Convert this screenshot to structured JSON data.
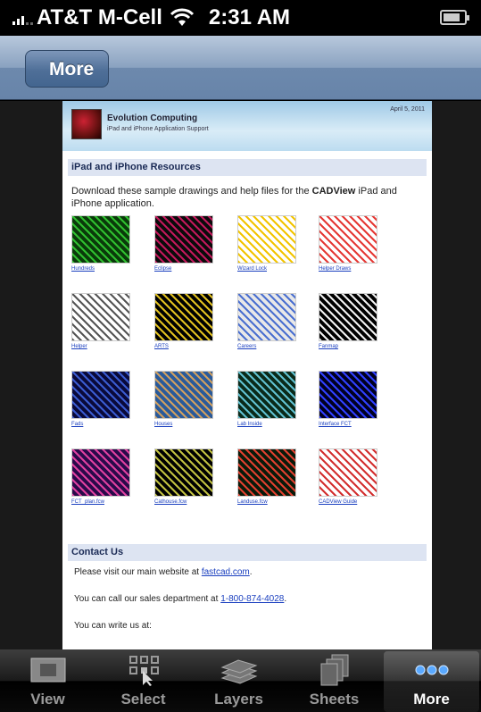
{
  "status_bar": {
    "carrier": "AT&T M-Cell",
    "time": "2:31 AM"
  },
  "nav": {
    "back_label": "More"
  },
  "page": {
    "company_name": "Evolution Computing",
    "company_sub": "iPad and iPhone Application Support",
    "header_date": "April 5, 2011",
    "resources_title": "iPad and iPhone Resources",
    "intro_prefix": "Download these sample drawings and help files for the ",
    "intro_app": "CADView",
    "intro_suffix": " iPad and iPhone application.",
    "thumbnails": [
      {
        "caption": "Hundreds",
        "colors": [
          "#0a3a0a",
          "#2fbf2f"
        ]
      },
      {
        "caption": "Eclipse",
        "colors": [
          "#0b0b0b",
          "#c2185b"
        ]
      },
      {
        "caption": "Wizard Lock",
        "colors": [
          "#ffffff",
          "#f2c400"
        ]
      },
      {
        "caption": "Helper Draws",
        "colors": [
          "#ffffff",
          "#e53935"
        ]
      },
      {
        "caption": "Helper",
        "colors": [
          "#ffffff",
          "#555555"
        ]
      },
      {
        "caption": "ARTS",
        "colors": [
          "#000000",
          "#e0c020"
        ]
      },
      {
        "caption": "Careers",
        "colors": [
          "#e8e8e8",
          "#4a6fd0"
        ]
      },
      {
        "caption": "Fanmap",
        "colors": [
          "#000000",
          "#f0f0f0"
        ]
      },
      {
        "caption": "Fads",
        "colors": [
          "#0a0a3a",
          "#3a5bd0"
        ]
      },
      {
        "caption": "Houses",
        "colors": [
          "#2a5a9a",
          "#d0a060"
        ]
      },
      {
        "caption": "Lab Inside",
        "colors": [
          "#0a2a1a",
          "#60c0d0"
        ]
      },
      {
        "caption": "Interface FCT",
        "colors": [
          "#000022",
          "#3040ff"
        ]
      },
      {
        "caption": "FCT_plan.fcw",
        "colors": [
          "#2a0a4a",
          "#e040a0"
        ]
      },
      {
        "caption": "Cathouse.fcw",
        "colors": [
          "#000000",
          "#c0c040"
        ]
      },
      {
        "caption": "Landuse.fcw",
        "colors": [
          "#0a1a0a",
          "#e04030"
        ]
      },
      {
        "caption": "CADView Guide",
        "colors": [
          "#ffffff",
          "#d32f2f"
        ]
      }
    ],
    "contact_title": "Contact Us",
    "contact_line1_prefix": "Please visit our main website at ",
    "contact_line1_link": "fastcad.com",
    "contact_line1_suffix": ".",
    "contact_line2_prefix": "You can call our sales department at ",
    "contact_line2_link": "1-800-874-4028",
    "contact_line2_suffix": ".",
    "contact_line3": "You can write us at:"
  },
  "tabs": [
    {
      "label": "View",
      "icon": "view-icon"
    },
    {
      "label": "Select",
      "icon": "select-icon"
    },
    {
      "label": "Layers",
      "icon": "layers-icon"
    },
    {
      "label": "Sheets",
      "icon": "sheets-icon"
    },
    {
      "label": "More",
      "icon": "more-icon",
      "active": true
    }
  ]
}
